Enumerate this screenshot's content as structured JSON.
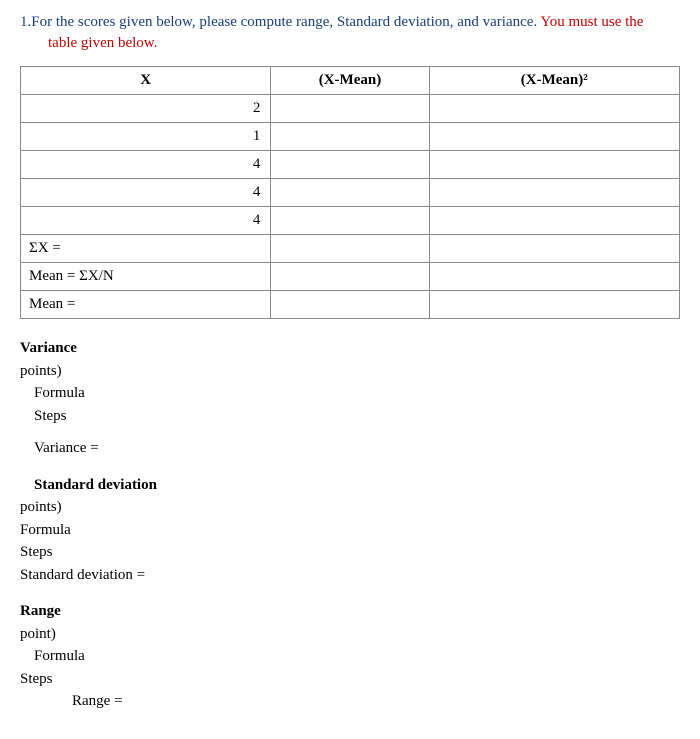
{
  "question": {
    "number": "1.",
    "text_part1": "For the scores given below, please compute range, Standard deviation, and variance. ",
    "text_highlight": "You must use the",
    "text_indent_highlight": "table given below."
  },
  "table": {
    "headers": {
      "x": "X",
      "xmean": "(X-Mean)",
      "xmean2": "(X-Mean)²"
    },
    "rows": [
      {
        "x": "2",
        "xmean": "",
        "xmean2": ""
      },
      {
        "x": "1",
        "xmean": "",
        "xmean2": ""
      },
      {
        "x": "4",
        "xmean": "",
        "xmean2": ""
      },
      {
        "x": "4",
        "xmean": "",
        "xmean2": ""
      },
      {
        "x": "4",
        "xmean": "",
        "xmean2": ""
      }
    ],
    "summary": [
      {
        "label": "ΣX =",
        "c2": "",
        "c3": ""
      },
      {
        "label": "Mean = ΣX/N",
        "c2": "",
        "c3": ""
      },
      {
        "label": "Mean =",
        "c2": "",
        "c3": ""
      }
    ]
  },
  "variance": {
    "title": "Variance",
    "points": "points)",
    "formula": "Formula",
    "steps": "Steps",
    "result": "Variance ="
  },
  "stddev": {
    "title": "Standard deviation",
    "points": "points)",
    "formula": "Formula",
    "steps": "Steps",
    "result": "Standard deviation ="
  },
  "range": {
    "title": "Range",
    "points": "point)",
    "formula": "Formula",
    "steps": "Steps",
    "result": "Range   ="
  }
}
